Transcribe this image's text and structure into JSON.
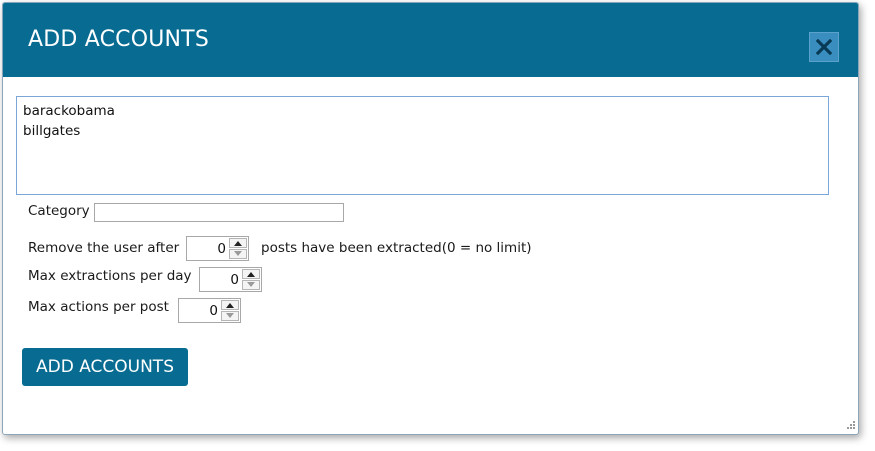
{
  "dialog": {
    "title": "ADD ACCOUNTS",
    "close_icon": "close-x-icon",
    "accent_color": "#086c92"
  },
  "accounts": {
    "lines": [
      "barackobama",
      "billgates"
    ]
  },
  "category": {
    "label": "Category",
    "value": ""
  },
  "remove_user": {
    "label": "Remove the user after",
    "value": "0",
    "suffix": "posts have been extracted(0 = no limit)"
  },
  "max_extractions": {
    "label": "Max extractions per day",
    "value": "0"
  },
  "max_actions": {
    "label": "Max actions per post",
    "value": "0"
  },
  "submit_button": {
    "label": "ADD ACCOUNTS"
  }
}
